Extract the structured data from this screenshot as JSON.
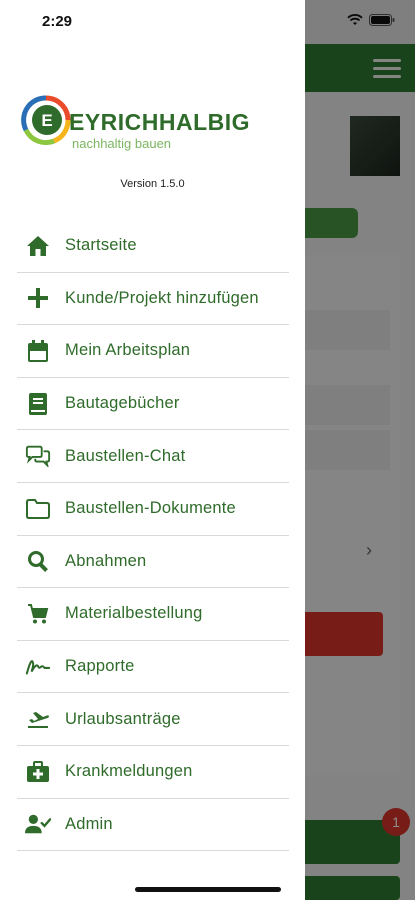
{
  "status_bar": {
    "time": "2:29"
  },
  "app": {
    "logo_text": "EYRICHHALBIG",
    "logo_tagline": "nachhaltig bauen",
    "version": "Version 1.5.0",
    "notification_count": "1"
  },
  "menu": {
    "items": [
      {
        "label": "Startseite",
        "icon": "home-icon"
      },
      {
        "label": "Kunde/Projekt hinzufügen",
        "icon": "plus-icon"
      },
      {
        "label": "Mein Arbeitsplan",
        "icon": "calendar-icon"
      },
      {
        "label": "Bautagebücher",
        "icon": "book-icon"
      },
      {
        "label": "Baustellen-Chat",
        "icon": "chat-icon"
      },
      {
        "label": "Baustellen-Dokumente",
        "icon": "folder-icon"
      },
      {
        "label": "Abnahmen",
        "icon": "search-icon"
      },
      {
        "label": "Materialbestellung",
        "icon": "cart-icon"
      },
      {
        "label": "Rapporte",
        "icon": "signature-icon"
      },
      {
        "label": "Urlaubsanträge",
        "icon": "plane-departure-icon"
      },
      {
        "label": "Krankmeldungen",
        "icon": "medkit-icon"
      },
      {
        "label": "Admin",
        "icon": "user-check-icon"
      }
    ]
  },
  "colors": {
    "brand_green": "#2f6b2a",
    "topbar_green": "#2e7d32",
    "alert_red": "#d9342b"
  }
}
